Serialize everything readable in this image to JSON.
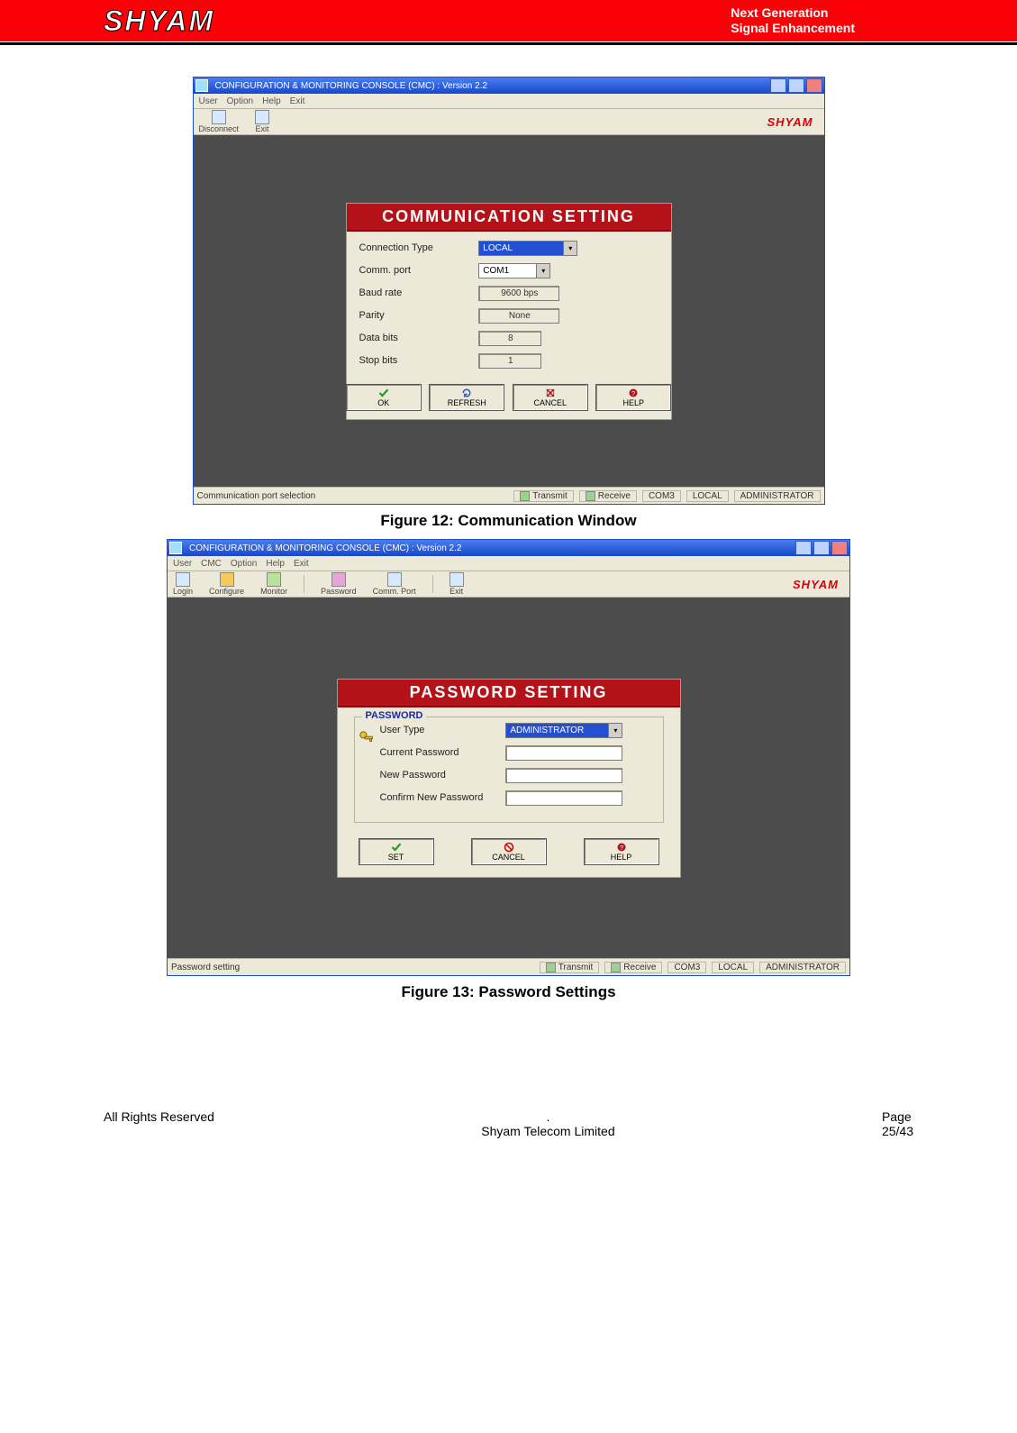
{
  "banner": {
    "logo": "SHYAM",
    "tag1": "Next Generation",
    "tag2": "Signal Enhancement"
  },
  "app_brand": "SHYAM",
  "win1": {
    "title": "CONFIGURATION & MONITORING CONSOLE (CMC)  :  Version 2.2",
    "menu": [
      "User",
      "Option",
      "Help",
      "Exit"
    ],
    "tool_disconnect": "Disconnect",
    "tool_exit": "Exit",
    "dialog": {
      "title": "COMMUNICATION SETTING",
      "rows": {
        "conn_type": {
          "label": "Connection Type",
          "value": "LOCAL"
        },
        "comm_port": {
          "label": "Comm. port",
          "value": "COM1"
        },
        "baud": {
          "label": "Baud rate",
          "value": "9600 bps"
        },
        "parity": {
          "label": "Parity",
          "value": "None"
        },
        "databits": {
          "label": "Data bits",
          "value": "8"
        },
        "stopbits": {
          "label": "Stop bits",
          "value": "1"
        }
      },
      "btn_ok": "OK",
      "btn_refresh": "REFRESH",
      "btn_cancel": "CANCEL",
      "btn_help": "HELP"
    },
    "status": {
      "left": "Communication port selection",
      "transmit": "Transmit",
      "receive": "Receive",
      "port": "COM3",
      "mode": "LOCAL",
      "user": "ADMINISTRATOR"
    }
  },
  "caption1": "Figure 12: Communication Window",
  "win2": {
    "title": "CONFIGURATION & MONITORING CONSOLE (CMC)  :  Version 2.2",
    "menu": [
      "User",
      "CMC",
      "Option",
      "Help",
      "Exit"
    ],
    "toolbar": {
      "login": "Login",
      "configure": "Configure",
      "monitor": "Monitor",
      "password": "Password",
      "commport": "Comm. Port",
      "exit": "Exit"
    },
    "dialog": {
      "title": "PASSWORD SETTING",
      "legend": "PASSWORD",
      "rows": {
        "usertype": {
          "label": "User Type",
          "value": "ADMINISTRATOR"
        },
        "current": {
          "label": "Current Password"
        },
        "newpw": {
          "label": "New Password"
        },
        "confirm": {
          "label": "Confirm New Password"
        }
      },
      "btn_set": "SET",
      "btn_cancel": "CANCEL",
      "btn_help": "HELP"
    },
    "status": {
      "left": "Password setting",
      "transmit": "Transmit",
      "receive": "Receive",
      "port": "COM3",
      "mode": "LOCAL",
      "user": "ADMINISTRATOR"
    }
  },
  "caption2": "Figure 13: Password Settings",
  "footer": {
    "dot": ".",
    "left": "All Rights Reserved",
    "mid": "Shyam Telecom Limited",
    "page_lbl": "Page",
    "page_num": "25/43"
  }
}
